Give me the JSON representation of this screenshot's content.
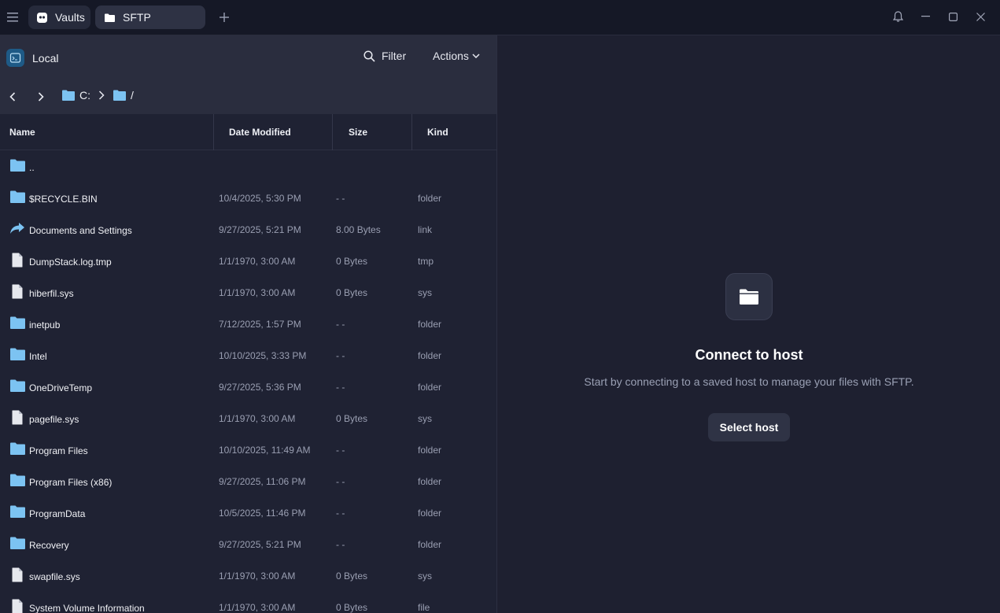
{
  "titlebar": {
    "tabs": [
      {
        "label": "Vaults",
        "icon": "vault-icon"
      },
      {
        "label": "SFTP",
        "icon": "folder-icon"
      }
    ]
  },
  "left_pane": {
    "location_label": "Local",
    "filter_label": "Filter",
    "actions_label": "Actions",
    "breadcrumb": [
      "C:",
      "/"
    ],
    "columns": [
      "Name",
      "Date Modified",
      "Size",
      "Kind"
    ],
    "files": [
      {
        "name": "..",
        "date": "",
        "size": "",
        "kind": "",
        "icon": "folder-icon"
      },
      {
        "name": "$RECYCLE.BIN",
        "date": "10/4/2025, 5:30 PM",
        "size": "- -",
        "kind": "folder",
        "icon": "folder-icon"
      },
      {
        "name": "Documents and Settings",
        "date": "9/27/2025, 5:21 PM",
        "size": "8.00 Bytes",
        "kind": "link",
        "icon": "link-arrow-icon"
      },
      {
        "name": "DumpStack.log.tmp",
        "date": "1/1/1970, 3:00 AM",
        "size": "0 Bytes",
        "kind": "tmp",
        "icon": "file-icon"
      },
      {
        "name": "hiberfil.sys",
        "date": "1/1/1970, 3:00 AM",
        "size": "0 Bytes",
        "kind": "sys",
        "icon": "file-icon"
      },
      {
        "name": "inetpub",
        "date": "7/12/2025, 1:57 PM",
        "size": "- -",
        "kind": "folder",
        "icon": "folder-icon"
      },
      {
        "name": "Intel",
        "date": "10/10/2025, 3:33 PM",
        "size": "- -",
        "kind": "folder",
        "icon": "folder-icon"
      },
      {
        "name": "OneDriveTemp",
        "date": "9/27/2025, 5:36 PM",
        "size": "- -",
        "kind": "folder",
        "icon": "folder-icon"
      },
      {
        "name": "pagefile.sys",
        "date": "1/1/1970, 3:00 AM",
        "size": "0 Bytes",
        "kind": "sys",
        "icon": "file-icon"
      },
      {
        "name": "Program Files",
        "date": "10/10/2025, 11:49 AM",
        "size": "- -",
        "kind": "folder",
        "icon": "folder-icon"
      },
      {
        "name": "Program Files (x86)",
        "date": "9/27/2025, 11:06 PM",
        "size": "- -",
        "kind": "folder",
        "icon": "folder-icon"
      },
      {
        "name": "ProgramData",
        "date": "10/5/2025, 11:46 PM",
        "size": "- -",
        "kind": "folder",
        "icon": "folder-icon"
      },
      {
        "name": "Recovery",
        "date": "9/27/2025, 5:21 PM",
        "size": "- -",
        "kind": "folder",
        "icon": "folder-icon"
      },
      {
        "name": "swapfile.sys",
        "date": "1/1/1970, 3:00 AM",
        "size": "0 Bytes",
        "kind": "sys",
        "icon": "file-icon"
      },
      {
        "name": "System Volume Information",
        "date": "1/1/1970, 3:00 AM",
        "size": "0 Bytes",
        "kind": "file",
        "icon": "file-icon"
      }
    ]
  },
  "right_pane": {
    "title": "Connect to host",
    "subtitle": "Start by connecting to a saved host to manage your files with SFTP.",
    "button_label": "Select host"
  },
  "colors": {
    "folder": "#7cc3f2",
    "file": "#e6e8ee",
    "background": "#1e2030",
    "titlebar": "#151826"
  }
}
